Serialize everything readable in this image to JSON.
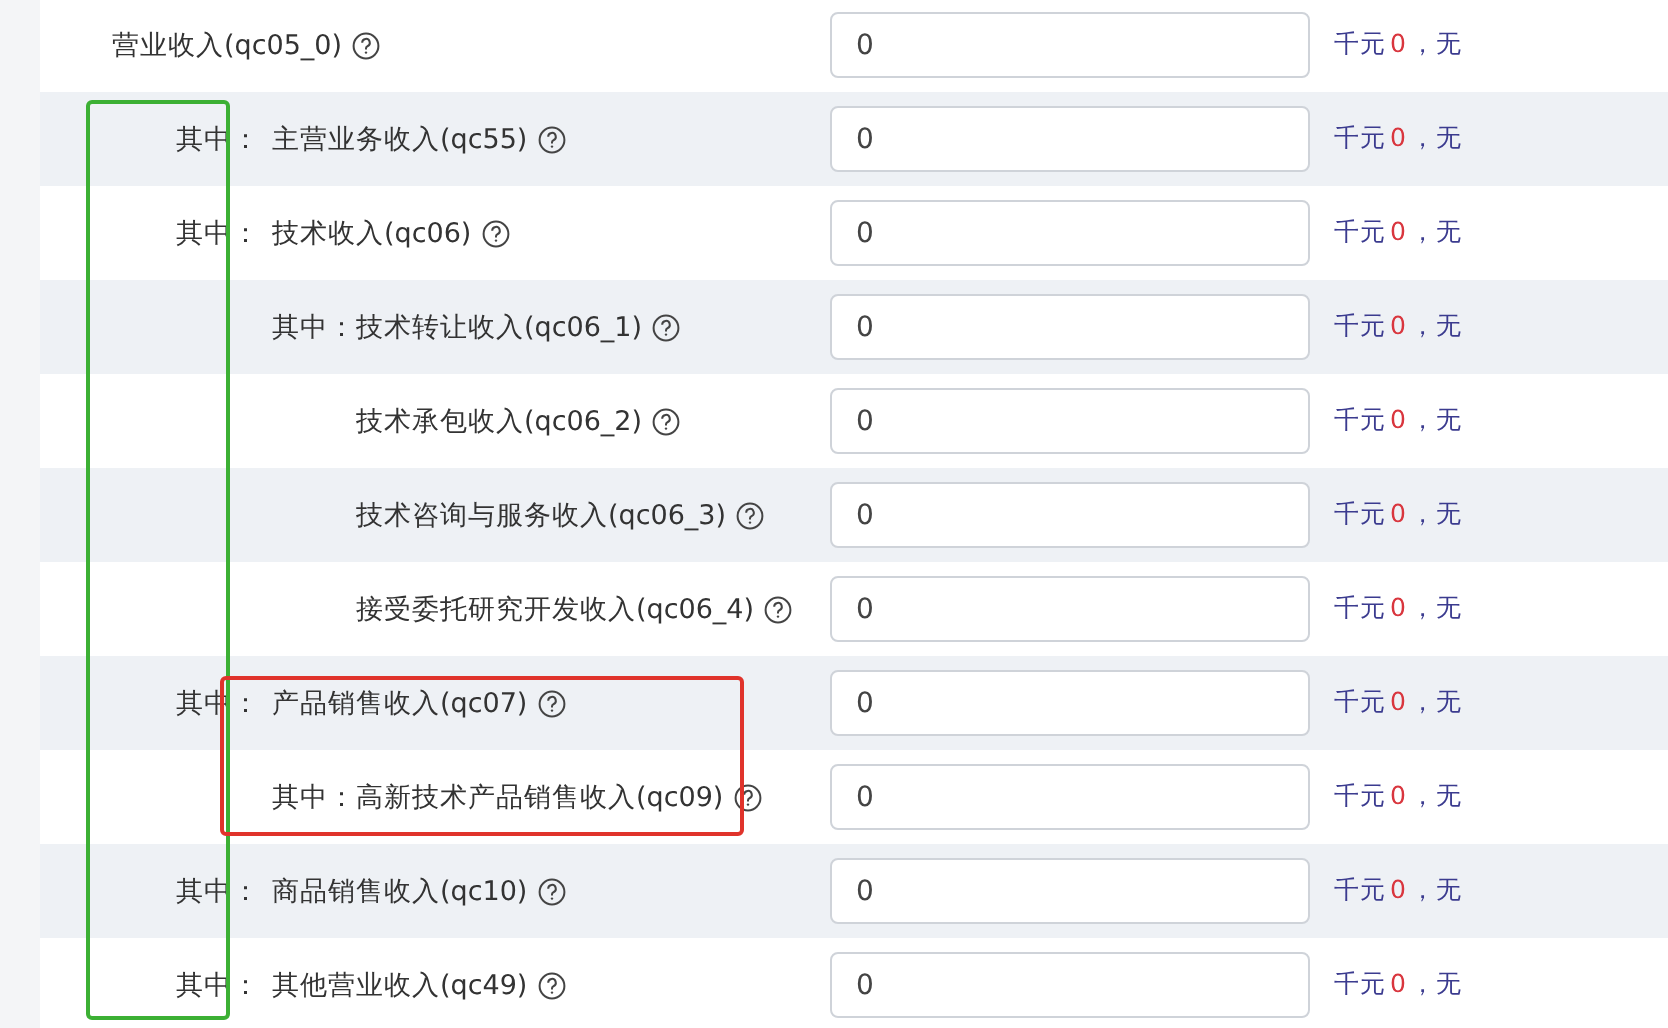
{
  "rows": [
    {
      "label": "营业收入(qc05_0)",
      "value": "0",
      "unit": "千元",
      "reading": "0",
      "note": "，无",
      "children": [
        {
          "prefix": "其中：",
          "label": "主营业务收入(qc55)",
          "value": "0",
          "unit": "千元",
          "reading": "0",
          "note": "，无"
        },
        {
          "prefix": "其中：",
          "label": "技术收入(qc06)",
          "value": "0",
          "unit": "千元",
          "reading": "0",
          "note": "，无",
          "children": [
            {
              "prefix": "其中：",
              "label": "技术转让收入(qc06_1)",
              "value": "0",
              "unit": "千元",
              "reading": "0",
              "note": "，无"
            },
            {
              "label": "技术承包收入(qc06_2)",
              "value": "0",
              "unit": "千元",
              "reading": "0",
              "note": "，无"
            },
            {
              "label": "技术咨询与服务收入(qc06_3)",
              "value": "0",
              "unit": "千元",
              "reading": "0",
              "note": "，无"
            },
            {
              "label": "接受委托研究开发收入(qc06_4)",
              "value": "0",
              "unit": "千元",
              "reading": "0",
              "note": "，无"
            }
          ]
        },
        {
          "prefix": "其中：",
          "label": "产品销售收入(qc07)",
          "value": "0",
          "unit": "千元",
          "reading": "0",
          "note": "，无",
          "children": [
            {
              "prefix": "其中：",
              "label": "高新技术产品销售收入(qc09)",
              "value": "0",
              "unit": "千元",
              "reading": "0",
              "note": "，无"
            }
          ]
        },
        {
          "prefix": "其中：",
          "label": "商品销售收入(qc10)",
          "value": "0",
          "unit": "千元",
          "reading": "0",
          "note": "，无"
        },
        {
          "prefix": "其中：",
          "label": "其他营业收入(qc49)",
          "value": "0",
          "unit": "千元",
          "reading": "0",
          "note": "，无"
        }
      ]
    }
  ],
  "annotations": [
    {
      "kind": "prefix-column",
      "color": "#3cb034"
    },
    {
      "kind": "product-group",
      "color": "#e0332b"
    }
  ]
}
